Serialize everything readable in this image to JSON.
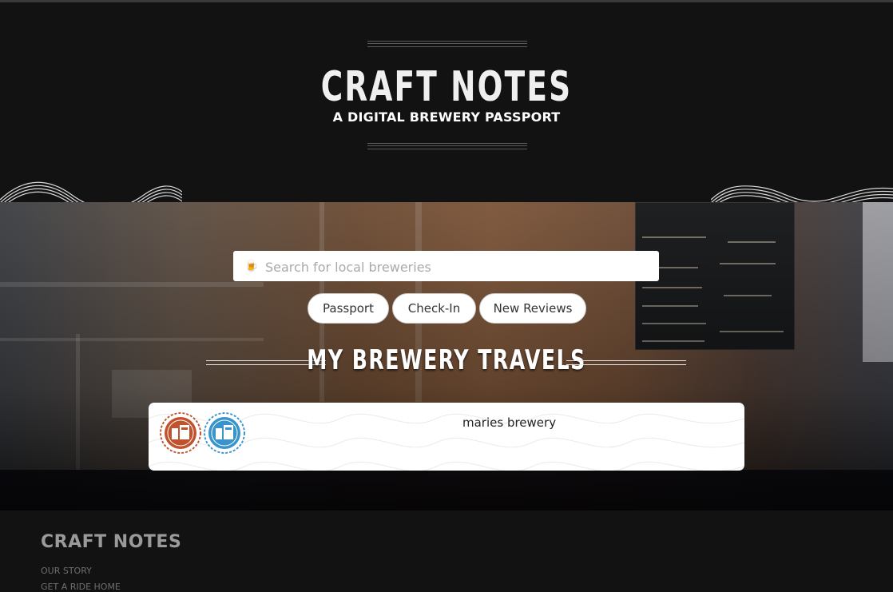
{
  "header": {
    "title": "CRAFT NOTES",
    "subtitle": "A DIGITAL BREWERY PASSPORT"
  },
  "search": {
    "placeholder": "Search for local breweries",
    "icon": "beer-mug-icon"
  },
  "nav_buttons": [
    {
      "label": "Passport"
    },
    {
      "label": "Check-In"
    },
    {
      "label": "New Reviews"
    }
  ],
  "section": {
    "title": "MY BREWERY TRAVELS"
  },
  "travels": [
    {
      "name": "maries brewery",
      "stamps": [
        {
          "icon": "brewery-stamp-icon",
          "color": "#c0532e"
        },
        {
          "icon": "brewery-stamp-icon",
          "color": "#3a94cc"
        }
      ]
    }
  ],
  "footer": {
    "brand": "CRAFT NOTES",
    "links": [
      "OUR STORY",
      "GET A RIDE HOME"
    ]
  },
  "colors": {
    "background": "#121212",
    "card": "#ffffff",
    "stamp_red": "#c0532e",
    "stamp_blue": "#3a94cc"
  }
}
